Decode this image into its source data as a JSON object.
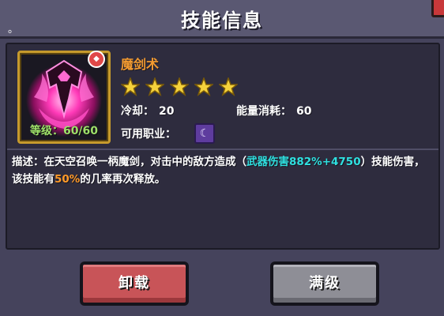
{
  "dialog": {
    "title": "技能信息",
    "top_mark": "。"
  },
  "skill": {
    "name": "魔剑术",
    "level_text": "等级：60/60",
    "badge_icon": "fire-badge-icon",
    "icon": "demon-sword-skill-icon",
    "stars_rating": 5,
    "stars_max": 5,
    "cooldown_label": "冷却：",
    "cooldown_value": "20",
    "energy_label": "能量消耗：",
    "energy_value": "60",
    "job_label": "可用职业：",
    "job_icon": "mage-class-icon"
  },
  "description": {
    "part1": "描述：在天空召唤一柄魔剑，对击中的敌方造成（",
    "highlight1": "武器伤害882%+4750",
    "part2": "）技能伤害，该技能有",
    "highlight2": "50%",
    "part3": "的几率再次释放。"
  },
  "buttons": {
    "unload": "卸载",
    "max": "满级"
  },
  "colors": {
    "name": "#f29a30",
    "highlight_cyan": "#2fe0e0",
    "highlight_orange": "#ff9a28",
    "level": "#9ee06a",
    "star": "#f5d23c",
    "unload_button": "#c85458",
    "max_button": "#8e8e96"
  }
}
